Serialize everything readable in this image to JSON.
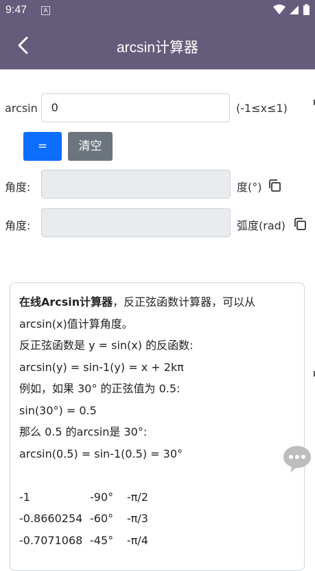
{
  "status": {
    "time": "9:47",
    "badge": "A"
  },
  "header": {
    "title": "arcsin计算器"
  },
  "form": {
    "arcsin_label": "arcsin",
    "arcsin_value": "0",
    "range_hint": "(-1≤x≤1)",
    "eq_label": "=",
    "clear_label": "清空",
    "deg_label": "角度:",
    "deg_value": "",
    "deg_unit": "度(°)",
    "rad_label": "角度:",
    "rad_value": "",
    "rad_unit": "弧度(rad)"
  },
  "info": {
    "intro_bold": "在线Arcsin计算器",
    "intro_rest": "，反正弦函数计算器，可以从",
    "line2": "arcsin(x)值计算角度。",
    "line3": "反正弦函数是 y = sin(x) 的反函数:",
    "line4": "arcsin(y) = sin-1(y) = x + 2kπ",
    "line5": "例如，如果 30° 的正弦值为 0.5:",
    "line6": "sin(30°) = 0.5",
    "line7": "那么 0.5 的arcsin是 30°:",
    "line8": "arcsin(0.5) = sin-1(0.5) = 30°",
    "table": [
      [
        "-1",
        "-90°",
        "-π/2"
      ],
      [
        "-0.8660254",
        "-60°",
        "-π/3"
      ],
      [
        "-0.7071068",
        "-45°",
        "-π/4"
      ]
    ]
  }
}
